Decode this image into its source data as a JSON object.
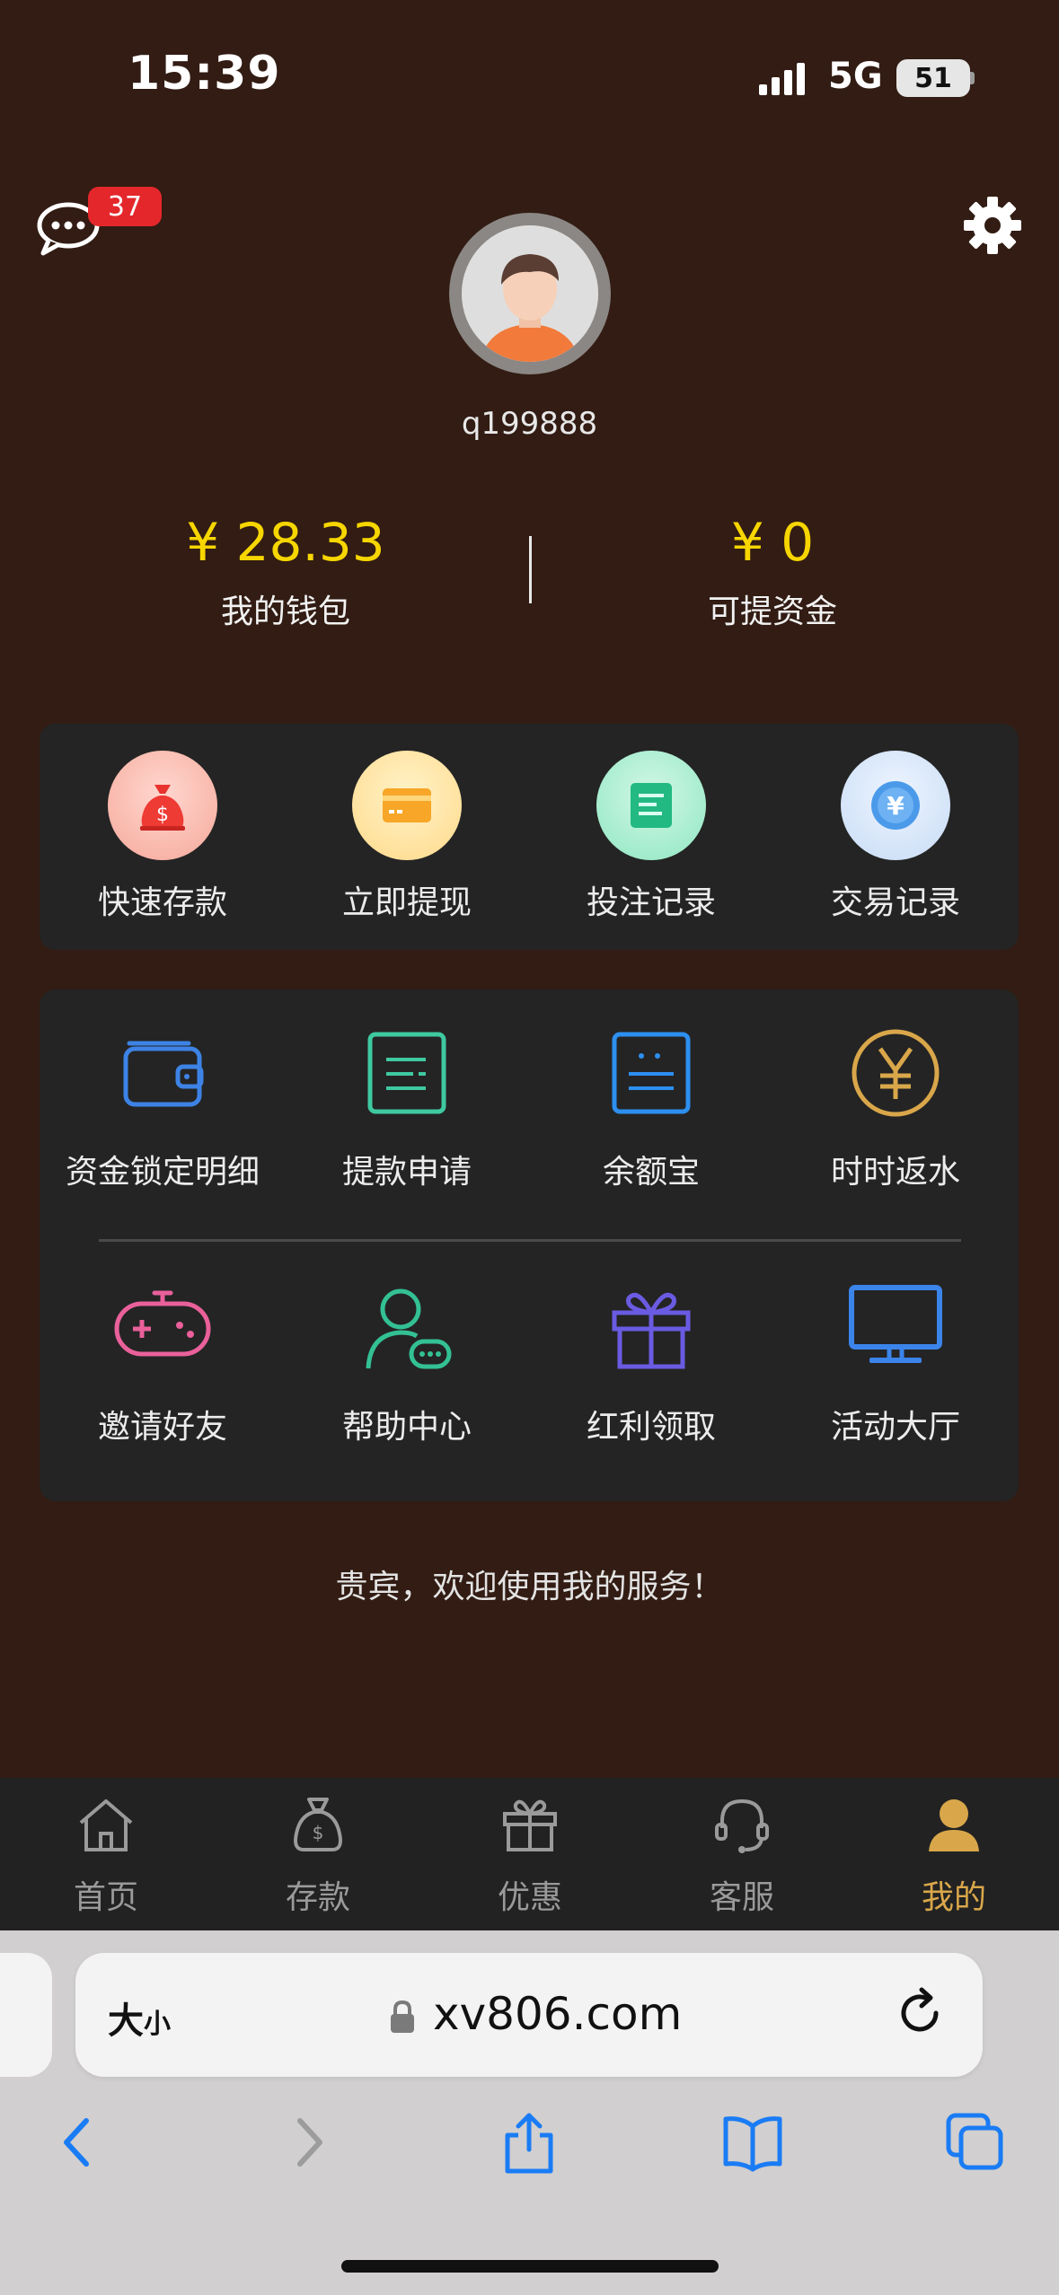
{
  "status_bar": {
    "time": "15:39",
    "network": "5G",
    "battery": "51"
  },
  "header": {
    "message_count": "37",
    "username": "q199888"
  },
  "balances": [
    {
      "amount": "¥ 28.33",
      "label": "我的钱包"
    },
    {
      "amount": "¥ 0",
      "label": "可提资金"
    }
  ],
  "quick_actions": [
    {
      "label": "快速存款",
      "icon": "money-bag-icon",
      "color": "#f0443c"
    },
    {
      "label": "立即提现",
      "icon": "card-icon",
      "color": "#f5a623"
    },
    {
      "label": "投注记录",
      "icon": "document-icon",
      "color": "#27c08a"
    },
    {
      "label": "交易记录",
      "icon": "yen-coin-icon",
      "color": "#3b8fe5"
    }
  ],
  "grid_items": [
    {
      "label": "资金锁定明细",
      "icon": "wallet-icon",
      "color": "#3d83e6"
    },
    {
      "label": "提款申请",
      "icon": "list-icon",
      "color": "#3ec9a1"
    },
    {
      "label": "余额宝",
      "icon": "lines-icon",
      "color": "#2d8ff0"
    },
    {
      "label": "时时返水",
      "icon": "yen-circle-icon",
      "color": "#d9a74a"
    },
    {
      "label": "邀请好友",
      "icon": "gamepad-icon",
      "color": "#e9609a"
    },
    {
      "label": "帮助中心",
      "icon": "support-user-icon",
      "color": "#33c194"
    },
    {
      "label": "红利领取",
      "icon": "gift-icon",
      "color": "#6a5be2"
    },
    {
      "label": "活动大厅",
      "icon": "monitor-icon",
      "color": "#3b84e9"
    }
  ],
  "welcome": "贵宾，欢迎使用我的服务！",
  "bottom_nav": [
    {
      "label": "首页",
      "icon": "home-icon"
    },
    {
      "label": "存款",
      "icon": "money-bag-icon"
    },
    {
      "label": "优惠",
      "icon": "gift-icon"
    },
    {
      "label": "客服",
      "icon": "headset-icon"
    },
    {
      "label": "我的",
      "icon": "user-icon",
      "active": true
    }
  ],
  "browser": {
    "text_size_label": "大小",
    "url": "xv806.com"
  }
}
